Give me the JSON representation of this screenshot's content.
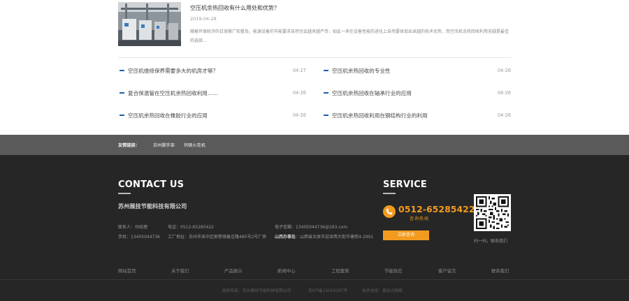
{
  "featured": {
    "title": "空压机余热回收有什么用处和优势？",
    "date": "2019-04-28",
    "desc": "随着环保经济的日渐推广和普及，能源设备的节能要求自然也会越来越严苛，如此一来在设备性能的进化上自然要体现出卓越的技术优势，而空压机余热回收利用无疑是最佳的选择..."
  },
  "news_left": [
    {
      "title": "空压机维修保养需要多大的机房才够？",
      "date": "04-27"
    },
    {
      "title": "复合保温管在空压机余热回收利用……",
      "date": "04-26"
    },
    {
      "title": "空压机余热回收在橡胶行业的应用",
      "date": "04-26"
    }
  ],
  "news_right": [
    {
      "title": "空压机余热回收的专业性",
      "date": "04-26"
    },
    {
      "title": "空压机余热回收在轴承行业的应用",
      "date": "04-26"
    },
    {
      "title": "空压机余热回收利用在钢结构行业的利用",
      "date": "04-26"
    }
  ],
  "links": {
    "label": "友情链接：",
    "items": [
      "苏州脚手架",
      "钨钢火花机"
    ]
  },
  "contact": {
    "title": "CONTACT  US",
    "company": "苏州展技节能科技有限公司",
    "contact_person": "联系人：孙经理",
    "tel": "电话：0512-65285422",
    "email": "电子信箱：13405044736@163.com",
    "mobile": "手机：13405044736",
    "factory": "工厂地址：苏州市吴中区郭巷镇善庄路485号2号厂房",
    "office_label": "山西办事处",
    "office_addr": "：山西省太原市迎泽西大街华塘苑4-2901"
  },
  "service": {
    "title": "SERVICE",
    "phone": "0512-65285422",
    "hotline": "咨询热线",
    "consult": "立即咨询",
    "qr_caption": "扫一扫，联系我们"
  },
  "footer_nav": [
    "网站首页",
    "关于我们",
    "产品展示",
    "新闻中心",
    "工程案例",
    "节能效应",
    "客户留言",
    "联系我们"
  ],
  "copyright": {
    "owner": "版权所有：苏州展技节能科技有限公司",
    "icp": "苏ICP备12014197号",
    "support": "技术支持：易动力网络"
  },
  "colors": {
    "accent": "#f29b1f",
    "list_bullet": "#1e5fae",
    "footer_bg": "#262626",
    "linkbar_bg": "#5a5a5a"
  }
}
